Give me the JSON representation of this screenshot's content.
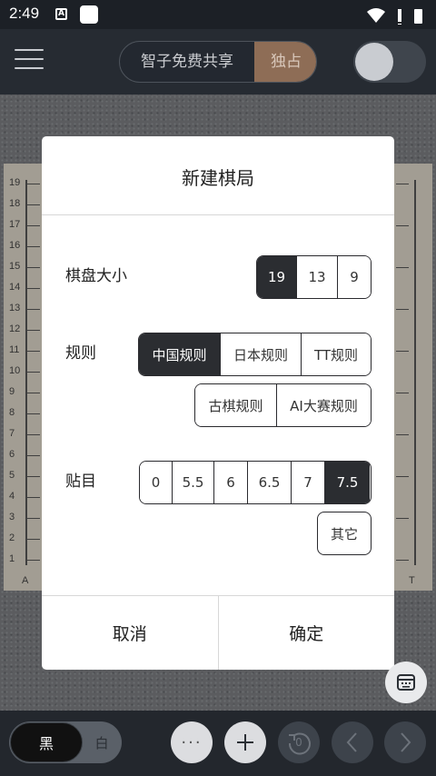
{
  "status_bar": {
    "time": "2:49",
    "notif_letter": "A"
  },
  "app_bar": {
    "segment": {
      "option_shared": "智子免费共享",
      "option_exclusive": "独占"
    }
  },
  "board": {
    "row_labels": [
      "19",
      "18",
      "17",
      "16",
      "15",
      "14",
      "13",
      "12",
      "11",
      "10",
      "9",
      "8",
      "7",
      "6",
      "5",
      "4",
      "3",
      "2",
      "1"
    ],
    "col_left": "A",
    "col_right": "T"
  },
  "dialog": {
    "title": "新建棋局",
    "board_size": {
      "label": "棋盘大小",
      "options": [
        "19",
        "13",
        "9"
      ],
      "selected": "19"
    },
    "rules": {
      "label": "规则",
      "options": [
        "中国规则",
        "日本规则",
        "TT规则",
        "古棋规则",
        "AI大赛规则"
      ],
      "selected": "中国规则"
    },
    "komi": {
      "label": "贴目",
      "options": [
        "0",
        "5.5",
        "6",
        "6.5",
        "7",
        "7.5"
      ],
      "selected": "7.5",
      "other": "其它"
    },
    "cancel": "取消",
    "confirm": "确定"
  },
  "bottom_bar": {
    "black_label": "黑",
    "white_label": "白",
    "more_label": "···",
    "undo_count": "0"
  }
}
